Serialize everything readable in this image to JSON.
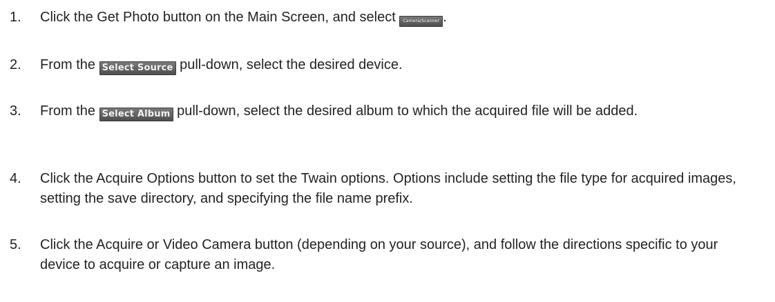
{
  "steps": [
    {
      "number": "1.",
      "text_before": "Click the Get Photo button on the Main Screen, and select ",
      "chip": "Camera/Scanner",
      "text_after": "."
    },
    {
      "number": "2.",
      "text_before": "From the ",
      "chip": "Select Source",
      "text_after": " pull-down, select the desired device."
    },
    {
      "number": "3.",
      "text_before": "From the ",
      "chip": "Select Album",
      "text_after": " pull-down, select the desired album to which the acquired file will be added."
    },
    {
      "number": "4.",
      "text": "Click the Acquire Options button to set the Twain options. Options include setting the file type for acquired images, setting the save directory, and specifying the file name prefix."
    },
    {
      "number": "5.",
      "text": "Click the Acquire or Video Camera button (depending on your source), and follow the directions specific to your device to acquire or capture an image."
    }
  ]
}
